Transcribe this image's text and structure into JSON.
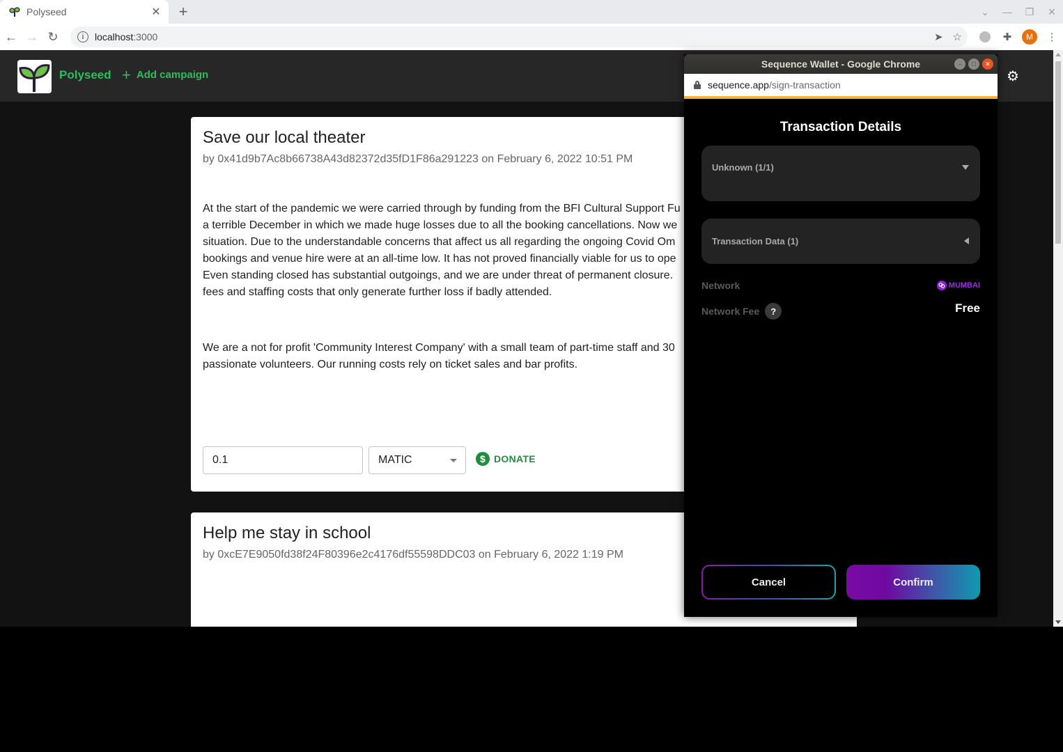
{
  "browser": {
    "tab_title": "Polyseed",
    "new_tab_label": "+",
    "url_host": "localhost",
    "url_port": ":3000",
    "profile_initial": "M"
  },
  "app": {
    "brand": "Polyseed",
    "add_campaign": "Add campaign",
    "colors": {
      "accent": "#2ebd5f",
      "donate": "#1e8e3e"
    }
  },
  "campaigns": [
    {
      "title": "Save our local theater",
      "meta": "by 0x41d9b7Ac8b66738A43d82372d35fD1F86a291223 on February 6, 2022 10:51 PM",
      "paragraphs": [
        "At the start of the pandemic we were carried through by funding from the BFI Cultural Support Fu a terrible December in which we made huge losses due to all the booking cancellations. Now we situation. Due to the understandable concerns that affect us all regarding the ongoing Covid Om bookings and venue hire were at an all-time low. It has not proved financially viable for us to ope Even standing closed has substantial outgoings, and we are under threat of permanent closure. fees and staffing costs that only generate further loss if badly attended.",
        "We are a not for profit 'Community Interest Company' with a small team of part-time staff and 30 passionate volunteers. Our running costs rely on ticket sales and bar profits."
      ],
      "lines1": [
        "At the start of the pandemic we were carried through by funding from the BFI Cultural Support Fu",
        "a terrible December in which we made huge losses due to all the booking cancellations. Now we",
        "situation. Due to the understandable concerns that affect us all regarding the ongoing Covid Om",
        "bookings and venue hire were at an all-time low. It has not proved financially viable for us to ope",
        "Even standing closed has substantial outgoings, and we are under threat of permanent closure.",
        "fees and staffing costs that only generate further loss if badly attended."
      ],
      "lines2": [
        "We are a not for profit 'Community Interest Company' with a small team of part-time staff and 30",
        "passionate volunteers. Our running costs rely on ticket sales and bar profits."
      ],
      "donation_amount": "0.1",
      "currency": "MATIC",
      "donate_label": "DONATE"
    },
    {
      "title": "Help me stay in school",
      "meta": "by 0xcE7E9050fd38f24F80396e2c4176df55598DDC03 on February 6, 2022 1:19 PM"
    }
  ],
  "popup": {
    "window_title": "Sequence Wallet - Google Chrome",
    "url_host": "sequence.app",
    "url_path": "/sign-transaction",
    "heading": "Transaction Details",
    "accordion1": "Unknown (1/1)",
    "accordion2": "Transaction Data (1)",
    "network_label": "Network",
    "network_value": "MUMBAI",
    "fee_label": "Network Fee",
    "fee_help": "?",
    "fee_value": "Free",
    "cancel": "Cancel",
    "confirm": "Confirm"
  }
}
